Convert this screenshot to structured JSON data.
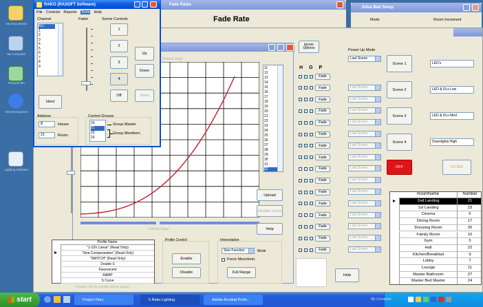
{
  "desktop": {
    "icons": [
      {
        "label": "My Documents"
      },
      {
        "label": "My Computer"
      },
      {
        "label": "Recycle Bin"
      },
      {
        "label": "Internet Explorer"
      },
      {
        "label": "Lighting Software"
      }
    ]
  },
  "bg_windows": {
    "fade_rates_title": "Fade Rates",
    "fade_rates_heading": "Fade Rate",
    "bed_setup_title": "Adva Bed Setup",
    "bed_mode": "Mode",
    "bed_room_increment": "Room Increment"
  },
  "rako": {
    "title": "RAKO (RASOFT Software)",
    "menu": [
      "File",
      "Controls",
      "Reports",
      "Tools",
      "Help"
    ],
    "channel_label": "Channel",
    "fader_label": "Fader",
    "scene_controls_label": "Scene Controls",
    "channels": [
      "ALL",
      "1",
      "2",
      "3",
      "4",
      "5",
      "6",
      "7",
      "8",
      "9"
    ],
    "scene_buttons": [
      "1",
      "2",
      "3",
      "4",
      "Off",
      "Store"
    ],
    "up": "Up",
    "down": "Down",
    "ident": "Ident",
    "address_label": "Address",
    "house_value": "8",
    "house_label": "House",
    "room_value": "21",
    "room_label": "Room",
    "control_groups_label": "Control Groups",
    "groups": [
      "20",
      "21",
      "22",
      "23"
    ],
    "group_master": "Group Master",
    "group_members": "Group Members"
  },
  "main": {
    "curve_caption": "(Preset Only)",
    "number_list": [
      "11",
      "12",
      "13",
      "14",
      "15",
      "16",
      "17",
      "18",
      "19",
      "20",
      "21",
      "22",
      "23",
      "24",
      "25",
      "26",
      "27",
      "28",
      "29",
      "30",
      "31",
      "32"
    ],
    "selected_number": "32",
    "upload": "Upload",
    "disable_curve": "Disable Curve",
    "help": "Help",
    "current_value": "Current Value",
    "profile_table_header": "Profile Name",
    "profiles": [
      "\"1-10V Linear\" (Read Only)",
      "\"Sine Compensation\" (Read Only)",
      "\"SWITCH\" (Read Only)",
      "Double S",
      "Fluorescent",
      "RAMP",
      "S Curve"
    ],
    "profile_footnote": "* Double click on a profile before upload",
    "profile_control_label": "Profile Control",
    "enable": "Enable",
    "disable": "Disable",
    "interpolation_label": "Interpolation",
    "interp_value": "Sine Function",
    "mode_label": "Mode",
    "force_monotonic": "Force Monotonic",
    "full_range": "Full Range"
  },
  "options": {
    "ignore_options": "Ignore Options",
    "hgp": [
      "H",
      "G",
      "P"
    ],
    "fade": "Fade",
    "power_up_mode_label": "Power Up Mode",
    "power_up_value": "Last Scene",
    "rows": 16,
    "help": "Help"
  },
  "scenes": {
    "buttons": [
      "Scene 1",
      "Scene 2",
      "Scene 3",
      "Scene 4"
    ],
    "names": [
      "LED's",
      "LED & DLs Low",
      "LED & DLs Med",
      "Downlights High"
    ],
    "off": "OFF",
    "store": "STORE"
  },
  "rooms": {
    "header_name": "RoomName",
    "header_number": "Number",
    "rows": [
      {
        "name": "2nd Landing",
        "number": "21"
      },
      {
        "name": "1st Landing",
        "number": "23"
      },
      {
        "name": "Cinema",
        "number": "6"
      },
      {
        "name": "Dining Room",
        "number": "17"
      },
      {
        "name": "Dressing Room",
        "number": "26"
      },
      {
        "name": "Family Room",
        "number": "10"
      },
      {
        "name": "Gym",
        "number": "5"
      },
      {
        "name": "Hall",
        "number": "22"
      },
      {
        "name": "Kitchen/Breakfast",
        "number": "9"
      },
      {
        "name": "Lobby",
        "number": "7"
      },
      {
        "name": "Lounge",
        "number": "11"
      },
      {
        "name": "Master Bathroom",
        "number": "27"
      },
      {
        "name": "Master Bed Master",
        "number": "24"
      }
    ]
  },
  "taskbar": {
    "start": "start",
    "tasks": [
      "Project Files",
      "5 Rako Lighting",
      "Adobe Acrobat Profe..."
    ],
    "tray_text": "My Computer"
  },
  "colors": {
    "curve": "#cc1a2a",
    "off_button": "#e0151a",
    "selection": "#316ac5"
  }
}
